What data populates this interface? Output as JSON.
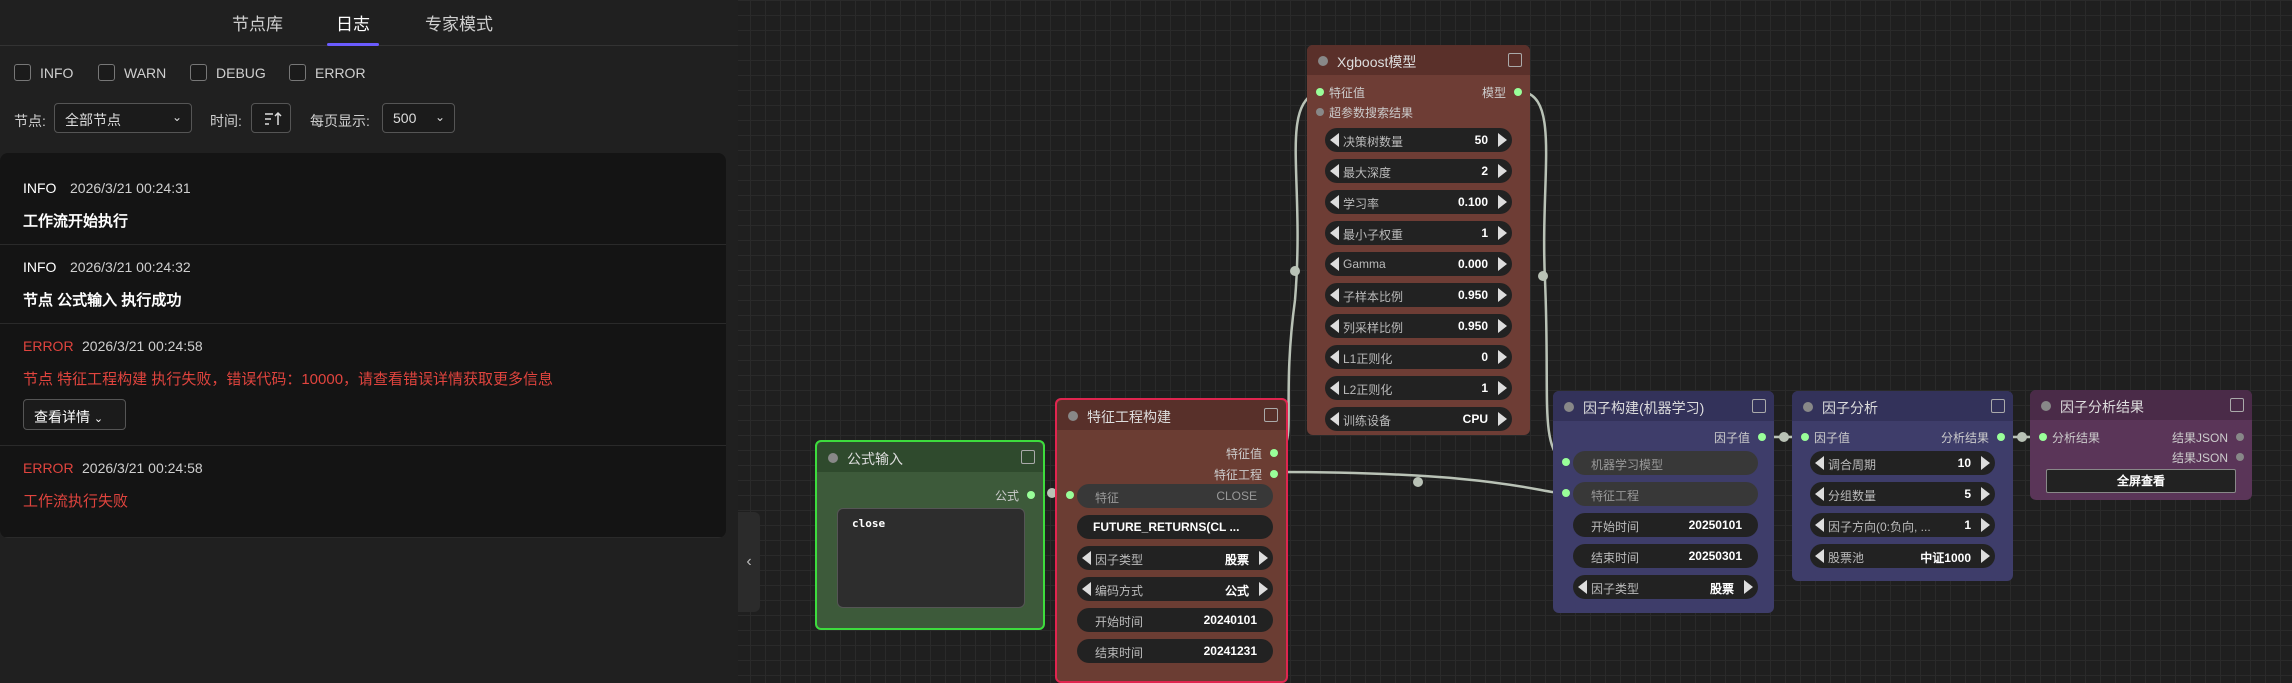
{
  "tabs": [
    "节点库",
    "日志",
    "专家模式"
  ],
  "active_tab": "日志",
  "filters": [
    "INFO",
    "WARN",
    "DEBUG",
    "ERROR"
  ],
  "controls": {
    "node_label": "节点:",
    "node_value": "全部节点",
    "time_label": "时间:",
    "page_label": "每页显示:",
    "page_value": "500"
  },
  "logs": [
    {
      "level": "INFO",
      "time": "2026/3/21 00:24:31",
      "message": "工作流开始执行"
    },
    {
      "level": "INFO",
      "time": "2026/3/21 00:24:32",
      "message": "节点 公式输入 执行成功"
    },
    {
      "level": "ERROR",
      "time": "2026/3/21 00:24:58",
      "message": "节点 特征工程构建 执行失败，错误代码：10000，请查看错误详情获取更多信息",
      "action": "查看详情"
    },
    {
      "level": "ERROR",
      "time": "2026/3/21 00:24:58",
      "message": "工作流执行失败"
    }
  ],
  "colors": {
    "info": "#ffffff",
    "error": "#e0443e",
    "accent": "#6b5cff"
  },
  "nodes": {
    "formula": {
      "title": "公式输入",
      "out": "公式",
      "code": "close"
    },
    "feature": {
      "title": "特征工程构建",
      "outs": [
        "特征值",
        "特征工程"
      ],
      "in": "特征",
      "widgets": [
        {
          "label": "特征",
          "value": "CLOSE"
        },
        {
          "label": "",
          "value": "FUTURE_RETURNS(CL ..."
        },
        {
          "label": "因子类型",
          "value": "股票"
        },
        {
          "label": "编码方式",
          "value": "公式"
        },
        {
          "label": "开始时间",
          "value": "20240101"
        },
        {
          "label": "结束时间",
          "value": "20241231"
        }
      ]
    },
    "xgb": {
      "title": "Xgboost模型",
      "in1": "特征值",
      "in2": "超参数搜索结果",
      "out": "模型",
      "widgets": [
        {
          "label": "决策树数量",
          "value": "50"
        },
        {
          "label": "最大深度",
          "value": "2"
        },
        {
          "label": "学习率",
          "value": "0.100"
        },
        {
          "label": "最小子权重",
          "value": "1"
        },
        {
          "label": "Gamma",
          "value": "0.000"
        },
        {
          "label": "子样本比例",
          "value": "0.950"
        },
        {
          "label": "列采样比例",
          "value": "0.950"
        },
        {
          "label": "L1正则化",
          "value": "0"
        },
        {
          "label": "L2正则化",
          "value": "1"
        },
        {
          "label": "训练设备",
          "value": "CPU"
        }
      ]
    },
    "factor_ml": {
      "title": "因子构建(机器学习)",
      "out": "因子值",
      "ins": [
        "机器学习模型",
        "特征工程"
      ],
      "widgets": [
        {
          "label": "开始时间",
          "value": "20250101"
        },
        {
          "label": "结束时间",
          "value": "20250301"
        },
        {
          "label": "因子类型",
          "value": "股票"
        }
      ]
    },
    "factor_analysis": {
      "title": "因子分析",
      "in": "因子值",
      "out": "分析结果",
      "widgets": [
        {
          "label": "调合周期",
          "value": "10"
        },
        {
          "label": "分组数量",
          "value": "5"
        },
        {
          "label": "因子方向(0:负向, ...",
          "value": "1"
        },
        {
          "label": "股票池",
          "value": "中证1000"
        }
      ]
    },
    "result": {
      "title": "因子分析结果",
      "in": "分析结果",
      "outs": [
        "结果JSON",
        "结果JSON"
      ],
      "button": "全屏查看"
    }
  }
}
